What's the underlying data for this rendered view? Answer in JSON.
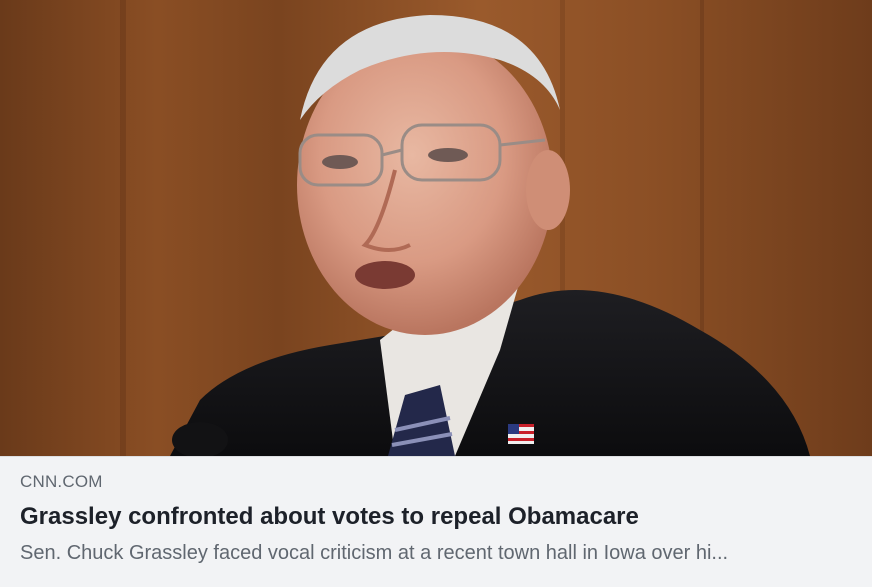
{
  "link_preview": {
    "image_alt": "Sen. Chuck Grassley speaking at a hearing",
    "source": "CNN.COM",
    "title": "Grassley confronted about votes to repeal Obamacare",
    "description": "Sen. Chuck Grassley faced vocal criticism at a recent town hall in Iowa over hi..."
  },
  "colors": {
    "meta_background": "#f2f3f5",
    "title_text": "#1d2129",
    "secondary_text": "#606770",
    "photo_background": "#8a4e24"
  }
}
